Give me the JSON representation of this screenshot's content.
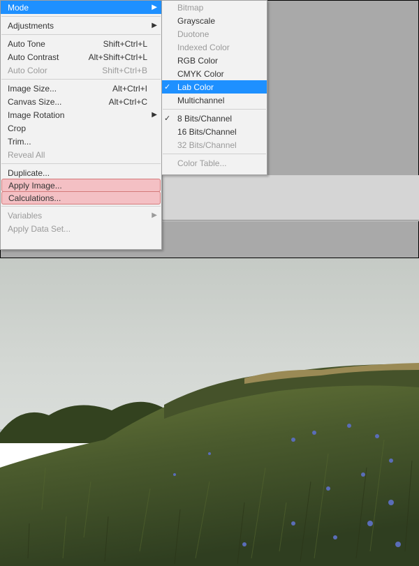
{
  "menu1": {
    "mode": "Mode",
    "adjustments": "Adjustments",
    "auto_tone": "Auto Tone",
    "auto_tone_sc": "Shift+Ctrl+L",
    "auto_contrast": "Auto Contrast",
    "auto_contrast_sc": "Alt+Shift+Ctrl+L",
    "auto_color": "Auto Color",
    "auto_color_sc": "Shift+Ctrl+B",
    "image_size": "Image Size...",
    "image_size_sc": "Alt+Ctrl+I",
    "canvas_size": "Canvas Size...",
    "canvas_size_sc": "Alt+Ctrl+C",
    "image_rotation": "Image Rotation",
    "crop": "Crop",
    "trim": "Trim...",
    "reveal_all": "Reveal All",
    "duplicate": "Duplicate...",
    "apply_image": "Apply Image...",
    "calculations": "Calculations...",
    "variables": "Variables",
    "apply_data_set": "Apply Data Set..."
  },
  "menu2": {
    "bitmap": "Bitmap",
    "grayscale": "Grayscale",
    "duotone": "Duotone",
    "indexed": "Indexed Color",
    "rgb": "RGB Color",
    "cmyk": "CMYK Color",
    "lab": "Lab Color",
    "multichannel": "Multichannel",
    "bits8": "8 Bits/Channel",
    "bits16": "16 Bits/Channel",
    "bits32": "32 Bits/Channel",
    "color_table": "Color Table..."
  },
  "photo_scene": {
    "sky_top": "#c7ccc8",
    "sky_bottom": "#d3d7d4",
    "hill_dark": "#3a4a2a",
    "hill_light": "#6a7a3e",
    "tree_dark": "#2e3e20",
    "water": "#b8c0be",
    "flower": "#5a6db8"
  }
}
